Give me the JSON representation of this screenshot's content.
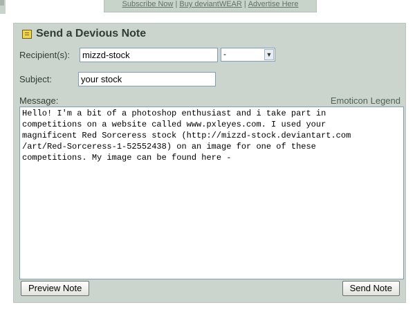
{
  "top_links": {
    "subscribe": "Subscribe Now",
    "buy": "Buy deviantWEAR",
    "advertise": "Advertise Here",
    "separator": "|"
  },
  "form": {
    "title": "Send a Devious Note",
    "recipients_label": "Recipient(s):",
    "recipients_value": "mizzd-stock",
    "recipient_select_value": "-",
    "subject_label": "Subject:",
    "subject_value": "your stock",
    "message_label": "Message:",
    "emoticon_legend": "Emoticon Legend",
    "message_value": "Hello! I'm a bit of a photoshop enthusiast and i take part in\ncompetitions on a website called www.pxleyes.com. I used your\nmagnificent Red Sorceress stock (http://mizzd-stock.deviantart.com\n/art/Red-Sorceress-1-52552438) on an image for one of these\ncompetitions. My image can be found here -",
    "preview_button": "Preview Note",
    "send_button": "Send Note"
  },
  "icons": {
    "title_icon": "note-icon",
    "select_arrow": "chevron-down-icon"
  },
  "colors": {
    "panel_bg": "#cbd5cd",
    "input_border": "#7f9db9"
  }
}
